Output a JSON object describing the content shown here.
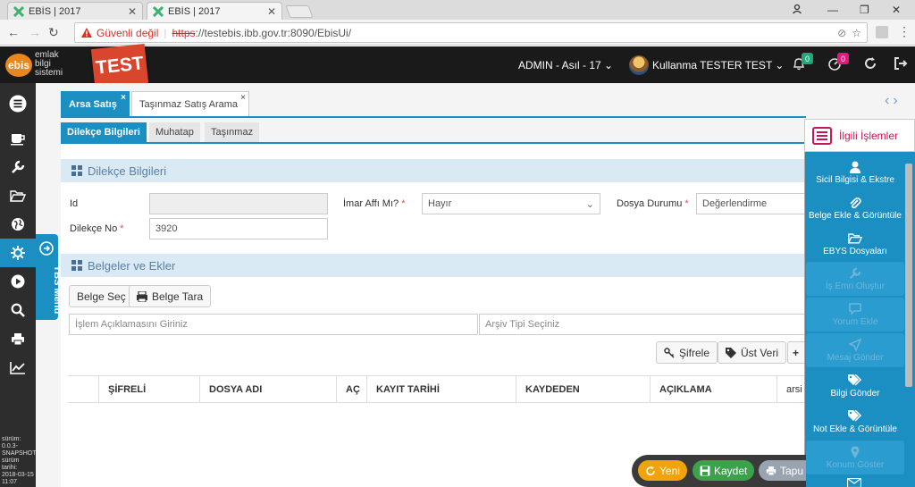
{
  "browser": {
    "tabs": [
      {
        "label": "EBİS | 2017"
      },
      {
        "label": "EBİS | 2017"
      }
    ],
    "security_label": "Güvenli değil",
    "url_scheme": "https",
    "url_rest": "://testebis.ibb.gov.tr:8090/EbisUi/"
  },
  "header": {
    "logo_badge": "ebis",
    "logo_line1": "emlak",
    "logo_line2": "bilgi",
    "logo_line3": "sistemi",
    "test_label": "TEST",
    "role": "ADMIN - Asıl - 17",
    "user": "Kullanma TESTER TEST",
    "notif_count": "0",
    "timer_count": "0",
    "colors": {
      "notif_badge": "#1fa87b",
      "timer_badge": "#e0197d",
      "accent": "#1b8fc2",
      "test_flag": "#d9462d"
    }
  },
  "sidebar": {
    "items": [
      "menu-icon",
      "coffee-icon",
      "wrench-icon",
      "folder-open-icon",
      "globe-icon",
      "gear-icon",
      "play-icon",
      "search-icon",
      "print-icon",
      "chart-icon"
    ],
    "active": "gear-icon",
    "ybs_label": "YBS Menü",
    "version_lines": [
      "sürüm:",
      "0.0.3-",
      "SNAPSHOT",
      "sürüm tarihi:",
      "2018-03-15",
      "11:07"
    ]
  },
  "page_tabs": [
    {
      "label": "Arsa Satış",
      "active": true
    },
    {
      "label": "Taşınmaz Satış Arama",
      "active": false
    }
  ],
  "sub_tabs": [
    {
      "label": "Dilekçe Bilgileri",
      "active": true
    },
    {
      "label": "Muhatap",
      "active": false
    },
    {
      "label": "Taşınmaz",
      "active": false
    }
  ],
  "dilekce": {
    "title": "Dilekçe Bilgileri",
    "id_label": "Id",
    "id_value": "",
    "imar_label": "İmar Affı Mı?",
    "imar_value": "Hayır",
    "durum_label": "Dosya Durumu",
    "durum_value": "Değerlendirme",
    "no_label": "Dilekçe No",
    "no_value": "3920"
  },
  "belgeler": {
    "title": "Belgeler ve Ekler",
    "btn_sec": "Belge Seç",
    "btn_tara": "Belge Tara",
    "aciklama_placeholder": "İşlem Açıklamasını Giriniz",
    "arsiv_placeholder": "Arşiv Tipi Seçiniz",
    "btn_sifrele": "Şifrele",
    "btn_ustveri": "Üst Veri",
    "columns": [
      "ŞİFRELİ",
      "DOSYA ADI",
      "AÇ",
      "KAYIT TARİHİ",
      "KAYDEDEN",
      "AÇIKLAMA",
      "arsi"
    ]
  },
  "related": {
    "title": "İlgili İşlemler",
    "items": [
      {
        "label": "Sicil Bilgisi & Ekstre",
        "icon": "user-icon",
        "enabled": true
      },
      {
        "label": "Belge Ekle & Görüntüle",
        "icon": "paperclip-icon",
        "enabled": true
      },
      {
        "label": "EBYS Dosyaları",
        "icon": "folder-open-icon",
        "enabled": true
      },
      {
        "label": "İş Emri Oluştur",
        "icon": "wrench-icon",
        "enabled": false
      },
      {
        "label": "Yorum Ekle",
        "icon": "comment-icon",
        "enabled": false
      },
      {
        "label": "Mesaj Gönder",
        "icon": "send-icon",
        "enabled": false
      },
      {
        "label": "Bilgi Gönder",
        "icon": "tags-icon",
        "enabled": true
      },
      {
        "label": "Not Ekle & Görüntüle",
        "icon": "tags-icon",
        "enabled": true
      },
      {
        "label": "Konum Göster",
        "icon": "map-marker-icon",
        "enabled": false
      }
    ]
  },
  "actions": {
    "yeni": "Yeni",
    "kaydet": "Kaydet",
    "tapu": "Tapu",
    "colors": {
      "yeni": "#f0a30a",
      "kaydet": "#3aa24a",
      "tapu": "#9aa3b0"
    }
  }
}
